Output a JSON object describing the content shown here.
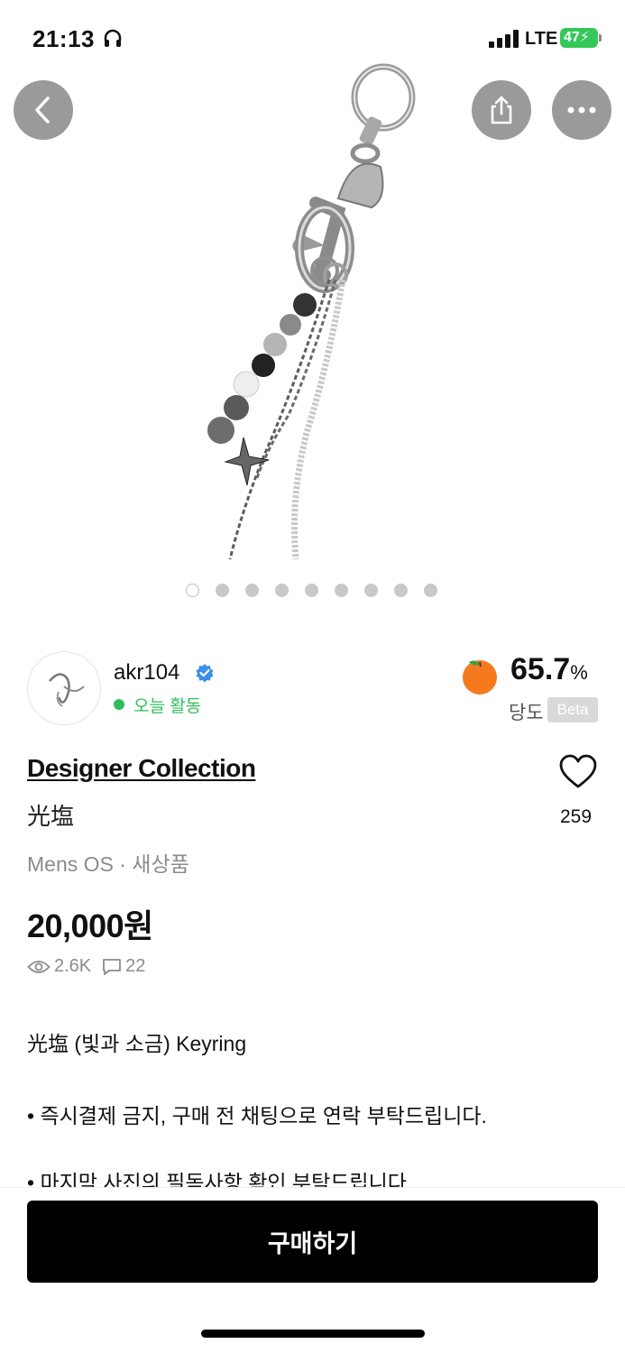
{
  "status_bar": {
    "time": "21:13",
    "network": "LTE",
    "battery": "47"
  },
  "gallery": {
    "image_count": 9,
    "active_index": 0
  },
  "seller": {
    "name": "akr104",
    "activity": "오늘 활동",
    "sweetness_value": "65.7",
    "sweetness_unit": "%",
    "sweetness_label": "당도",
    "beta_label": "Beta"
  },
  "product": {
    "brand": "Designer Collection",
    "name": "光塩",
    "category": "Mens OS · 새상품",
    "price": "20,000원",
    "likes": "259",
    "views": "2.6K",
    "comments": "22",
    "description": [
      "光塩 (빛과 소금) Keyring",
      "• 즉시결제 금지, 구매 전 채팅으로 연락 부탁드립니다.",
      "• 마지막 사진의 필독사항 확인 부탁드립니다"
    ]
  },
  "actions": {
    "buy_label": "구매하기"
  },
  "colors": {
    "online": "#2fbf5a",
    "button": "#000000",
    "battery": "#35c759",
    "peach": "#f57a1e"
  },
  "icons": [
    "back-icon",
    "share-icon",
    "more-icon",
    "verified-icon",
    "peach-icon",
    "heart-icon",
    "eye-icon",
    "comment-icon"
  ]
}
